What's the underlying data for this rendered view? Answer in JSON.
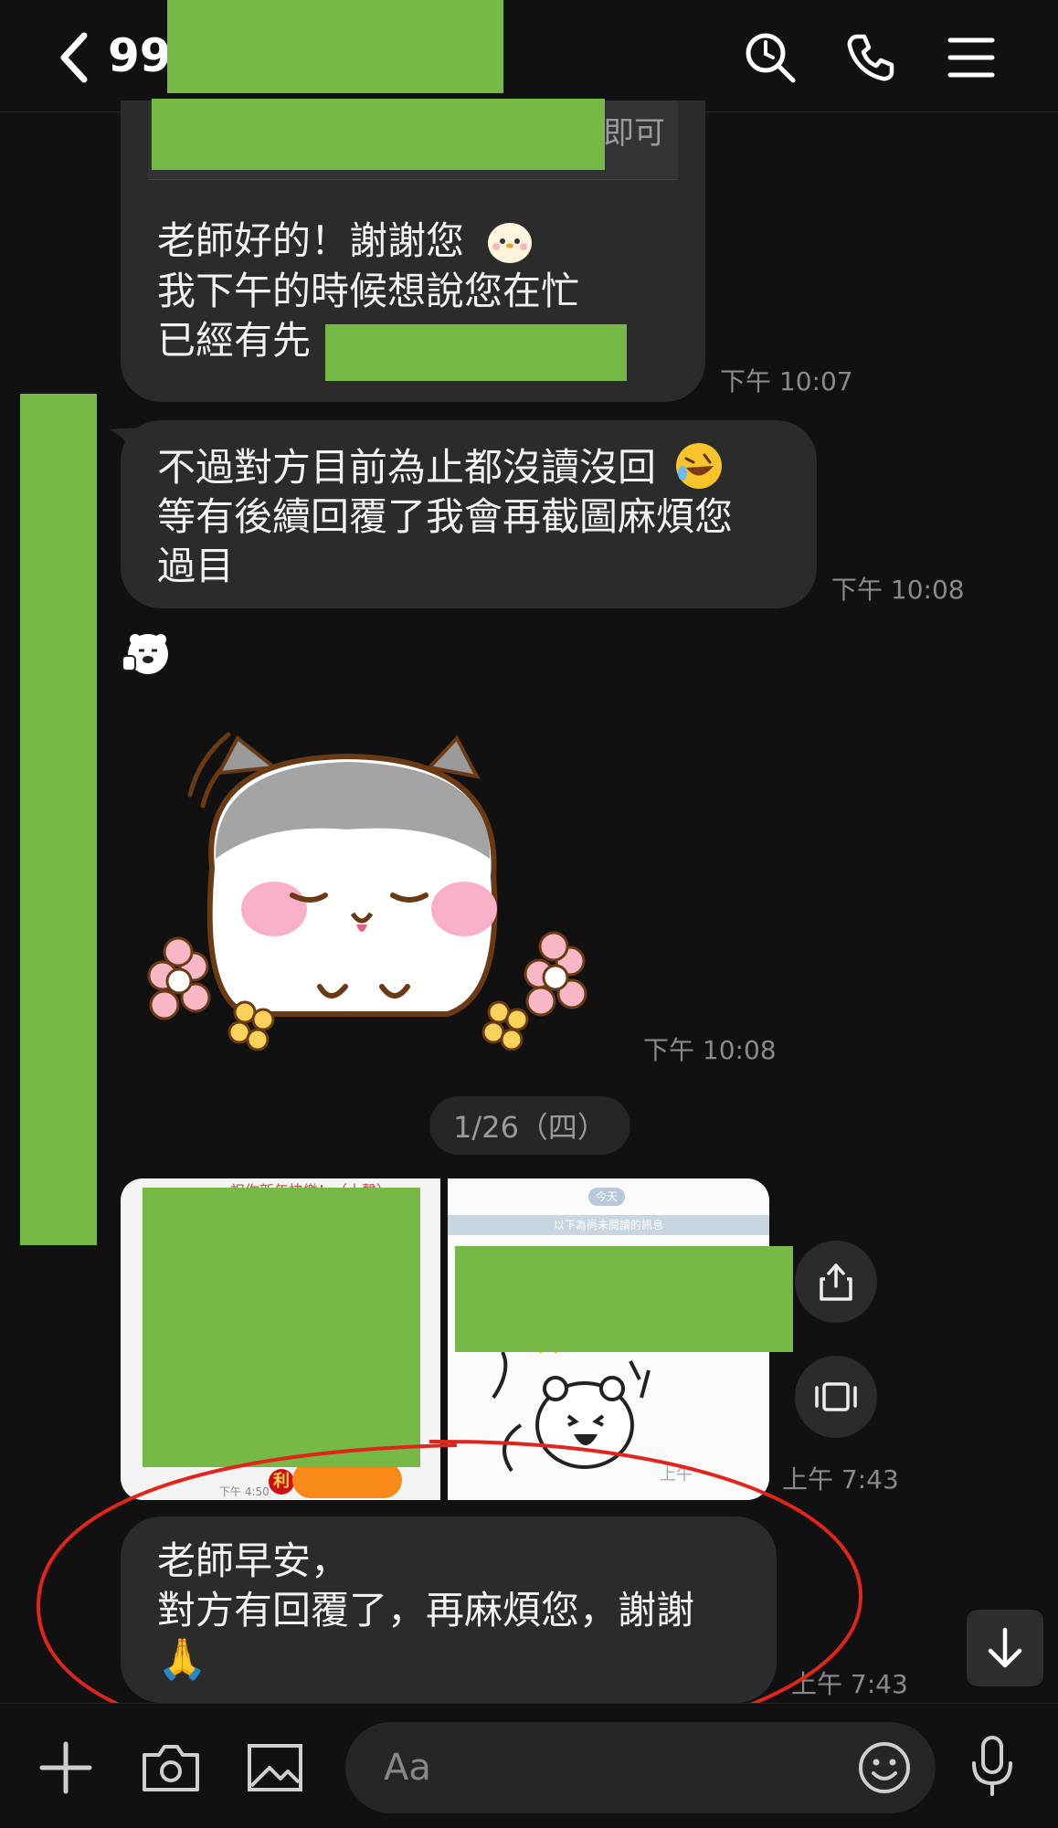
{
  "header": {
    "title": "99",
    "back_icon": "chevron-left-icon",
    "search_icon": "search-icon",
    "call_icon": "phone-icon",
    "menu_icon": "menu-icon"
  },
  "messages": {
    "quoted_fragment": "即可",
    "m1": {
      "lines": [
        "老師好的！謝謝您",
        "我下午的時候想說您在忙",
        "已經有先"
      ],
      "time": "下午 10:07"
    },
    "m2": {
      "lines": [
        "不過對方目前為止都沒讀沒回",
        "等有後續回覆了我會再截圖麻煩您",
        "過目"
      ],
      "time": "下午 10:08"
    },
    "sticker_time": "下午 10:08",
    "date_chip": "1/26（四）",
    "images": {
      "left_caption_top": "祝你新年快樂！（大聲）",
      "left_footer": "下午 4:50",
      "left_fortune": "利",
      "right_badge": "今天",
      "right_banner": "以下為尚未閱讀的訊息",
      "right_corner": "上午",
      "time": "上午 7:43"
    },
    "m3": {
      "lines": [
        "老師早安，",
        "對方有回覆了，再麻煩您，謝謝"
      ],
      "emoji": "🙏",
      "time": "上午 7:43"
    }
  },
  "input_bar": {
    "placeholder": "Aa"
  },
  "colors": {
    "background": "#111111",
    "bubble": "#2b2b2b",
    "redaction": "#76b947",
    "annotation": "#e0261c"
  }
}
